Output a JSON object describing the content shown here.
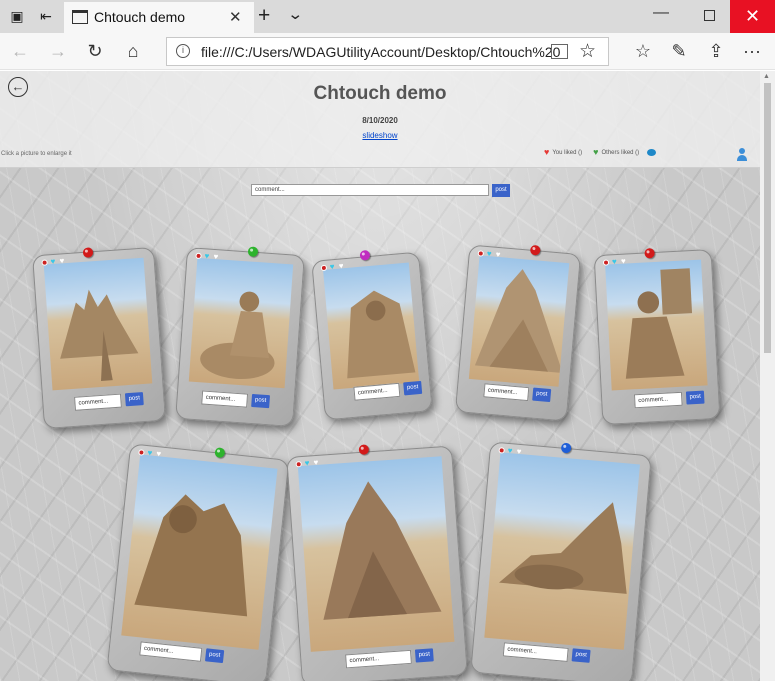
{
  "browser": {
    "tab_title": "Chtouch demo",
    "address": "file:///C:/Users/WDAGUtilityAccount/Desktop/Chtouch%20",
    "tab_close_glyph": "✕",
    "new_tab_glyph": "+",
    "window_close_glyph": "✕"
  },
  "page": {
    "title": "Chtouch demo",
    "date": "8/10/2020",
    "slideshow_link": "slideshow",
    "hint": "Click a picture to enlarge it",
    "legend_you": "You liked ()",
    "legend_others": "Others liked ()",
    "comment_placeholder": "comment...",
    "post_label": "post"
  },
  "colors": {
    "liked_by_you": "#e53935",
    "liked_by_others": "#43a047",
    "post_button": "#3a63c9",
    "window_close": "#e81123"
  },
  "icons": [
    "back-arrow-icon",
    "refresh-icon",
    "home-icon",
    "info-icon",
    "reader-view-icon",
    "favorite-star-icon",
    "favorites-list-icon",
    "pen-icon",
    "share-icon",
    "more-icon",
    "user-icon",
    "chat-icon",
    "heart-icon"
  ],
  "cards": [
    {
      "comment": "comment...",
      "post": "post",
      "pin_color": "#d21a1a"
    },
    {
      "comment": "comment...",
      "post": "post",
      "pin_color": "#2db32d"
    },
    {
      "comment": "comment...",
      "post": "post",
      "pin_color": "#c02cc0"
    },
    {
      "comment": "comment...",
      "post": "post",
      "pin_color": "#d21a1a"
    },
    {
      "comment": "comment...",
      "post": "post",
      "pin_color": "#d21a1a"
    },
    {
      "comment": "comment...",
      "post": "post",
      "pin_color": "#2db32d"
    },
    {
      "comment": "comment...",
      "post": "post",
      "pin_color": "#d21a1a"
    },
    {
      "comment": "comment...",
      "post": "post",
      "pin_color": "#1e5ed8"
    }
  ]
}
